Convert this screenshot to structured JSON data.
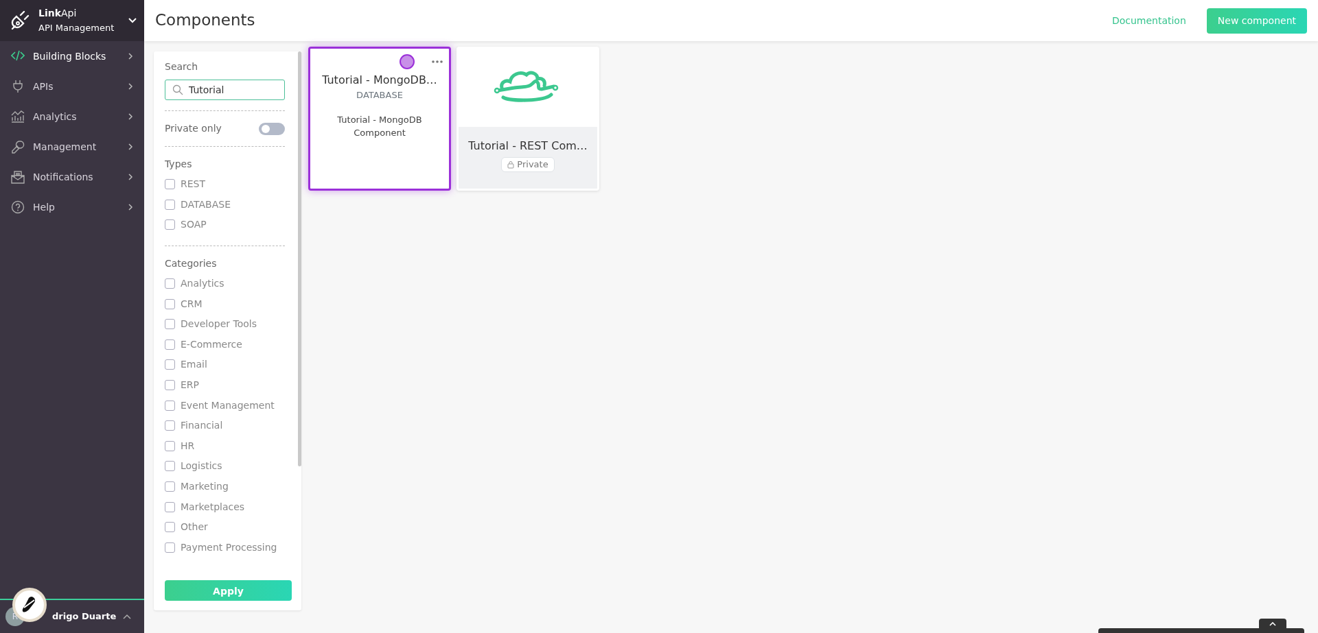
{
  "brand": {
    "name_bold": "Link",
    "name_rest": "Api",
    "subtitle": "API Management"
  },
  "sidebar": {
    "items": [
      {
        "label": "Building Blocks",
        "kind": "code",
        "selected": true
      },
      {
        "label": "APIs",
        "kind": "plug",
        "selected": false
      },
      {
        "label": "Analytics",
        "kind": "chart",
        "selected": false
      },
      {
        "label": "Management",
        "kind": "key",
        "selected": false
      },
      {
        "label": "Notifications",
        "kind": "mail",
        "selected": false
      },
      {
        "label": "Help",
        "kind": "help",
        "selected": false
      }
    ]
  },
  "user": {
    "initial": "R",
    "name": "drigo Duarte"
  },
  "header": {
    "title": "Components",
    "links": [
      "Documentation"
    ],
    "primary_button": "New component"
  },
  "filters": {
    "search_label": "Search",
    "search_value": "Tutorial",
    "private_label": "Private only",
    "private_on": false,
    "types_label": "Types",
    "types": [
      {
        "label": "REST",
        "checked": false
      },
      {
        "label": "DATABASE",
        "checked": false
      },
      {
        "label": "SOAP",
        "checked": false
      }
    ],
    "categories_label": "Categories",
    "categories": [
      {
        "label": "Analytics",
        "checked": false
      },
      {
        "label": "CRM",
        "checked": false
      },
      {
        "label": "Developer Tools",
        "checked": false
      },
      {
        "label": "E-Commerce",
        "checked": false
      },
      {
        "label": "Email",
        "checked": false
      },
      {
        "label": "ERP",
        "checked": false
      },
      {
        "label": "Event Management",
        "checked": false
      },
      {
        "label": "Financial",
        "checked": false
      },
      {
        "label": "HR",
        "checked": false
      },
      {
        "label": "Logistics",
        "checked": false
      },
      {
        "label": "Marketing",
        "checked": false
      },
      {
        "label": "Marketplaces",
        "checked": false
      },
      {
        "label": "Other",
        "checked": false
      },
      {
        "label": "Payment Processing",
        "checked": false
      }
    ],
    "apply": "Apply"
  },
  "cards": [
    {
      "kind": "detail",
      "title": "Tutorial - MongoDB…",
      "type": "DATABASE",
      "description": "Tutorial - MongoDB Component",
      "color": "#c890e8",
      "selected": true
    },
    {
      "kind": "logo",
      "title": "Tutorial - REST Com…",
      "badge": "Private",
      "selected": false
    }
  ]
}
